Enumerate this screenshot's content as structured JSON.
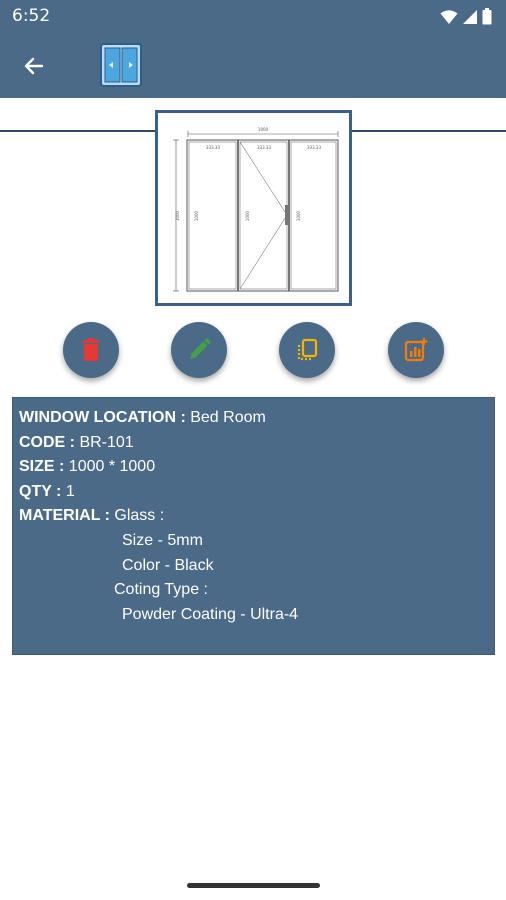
{
  "status_bar": {
    "time": "6:52"
  },
  "colors": {
    "primary": "#4a6a88",
    "delete": "#e53935",
    "edit": "#43a047",
    "copy": "#f4b400",
    "report": "#f57c00"
  },
  "toolbar": {
    "back_icon": "arrow-left-icon",
    "logo_icon": "sliding-window-icon"
  },
  "preview": {
    "overall_width_label": "1000",
    "height_label": "1000",
    "panel_width_labels": [
      "333.33",
      "333.33",
      "333.33"
    ],
    "panel_height_labels": [
      "1000",
      "1000",
      "1000"
    ]
  },
  "actions": [
    {
      "name": "delete-button",
      "icon": "trash-icon"
    },
    {
      "name": "edit-button",
      "icon": "pencil-icon"
    },
    {
      "name": "copy-button",
      "icon": "copy-icon"
    },
    {
      "name": "report-button",
      "icon": "chart-report-icon"
    }
  ],
  "details": {
    "location_label": "WINDOW LOCATION :",
    "location_value": " Bed Room",
    "code_label": "CODE :",
    "code_value": " BR-101",
    "size_label": "SIZE :",
    "size_value": " 1000 * 1000",
    "qty_label": "QTY :",
    "qty_value": " 1",
    "material_label": "MATERIAL :",
    "material_value": " Glass :",
    "glass_size": "Size - 5mm",
    "glass_color": "Color - Black",
    "coating_label": "Coting Type :",
    "coating_value": "Powder Coating - Ultra-4"
  }
}
